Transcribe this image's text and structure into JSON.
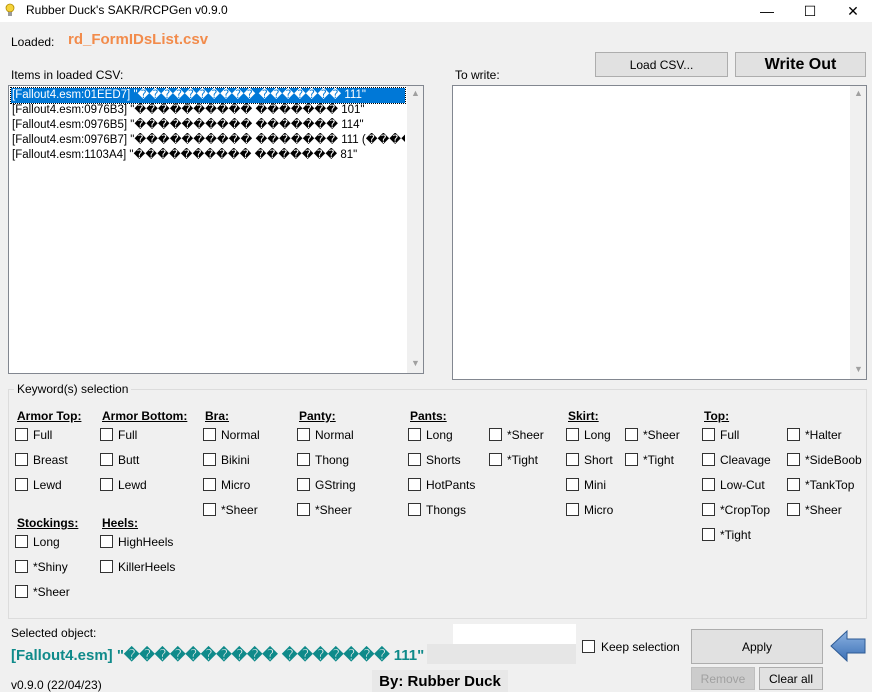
{
  "window": {
    "title": "Rubber Duck's SAKR/RCPGen v0.9.0",
    "minimize": "—",
    "maximize": "☐",
    "close": "✕"
  },
  "loaded": {
    "label": "Loaded:",
    "filename": "rd_FormIDsList.csv"
  },
  "csv_list": {
    "label": "Items in loaded CSV:",
    "items": [
      "[Fallout4.esm:01EED7] \"���������� ������� 111\"",
      "[Fallout4.esm:0976B3] \"���������� ������� 101\"",
      "[Fallout4.esm:0976B5] \"���������� ������� 114\"",
      "[Fallout4.esm:0976B7] \"���������� ������� 111 (�����",
      "[Fallout4.esm:1103A4] \"���������� ������� 81\""
    ]
  },
  "write_panel": {
    "label": "To write:",
    "load_csv": "Load CSV...",
    "write_out": "Write Out"
  },
  "keywords": {
    "group_title": "Keyword(s) selection",
    "armor_top": {
      "title": "Armor Top:",
      "options": [
        "Full",
        "Breast",
        "Lewd"
      ]
    },
    "armor_bottom": {
      "title": "Armor Bottom:",
      "options": [
        "Full",
        "Butt",
        "Lewd"
      ]
    },
    "bra": {
      "title": "Bra:",
      "options": [
        "Normal",
        "Bikini",
        "Micro",
        "*Sheer"
      ]
    },
    "panty": {
      "title": "Panty:",
      "options": [
        "Normal",
        "Thong",
        "GString",
        "*Sheer"
      ]
    },
    "pants": {
      "title": "Pants:",
      "options": [
        "Long",
        "Shorts",
        "HotPants",
        "Thongs",
        "*Sheer",
        "*Tight"
      ]
    },
    "skirt": {
      "title": "Skirt:",
      "options": [
        "Long",
        "Short",
        "Mini",
        "Micro",
        "*Sheer",
        "*Tight"
      ]
    },
    "top": {
      "title": "Top:",
      "options": [
        "Full",
        "Cleavage",
        "Low-Cut",
        "*CropTop",
        "*Tight",
        "*Halter",
        "*SideBoob",
        "*TankTop",
        "*Sheer"
      ]
    },
    "stockings": {
      "title": "Stockings:",
      "options": [
        "Long",
        "*Shiny",
        "*Sheer"
      ]
    },
    "heels": {
      "title": "Heels:",
      "options": [
        "HighHeels",
        "KillerHeels"
      ]
    }
  },
  "footer": {
    "selected_label": "Selected object:",
    "selected_value": "[Fallout4.esm] \"���������� ������� 111\"",
    "keep_selection": "Keep selection",
    "apply": "Apply",
    "remove": "Remove",
    "clear_all": "Clear all",
    "version": "v0.9.0 (22/04/23)",
    "author": "By: Rubber Duck"
  },
  "colors": {
    "loaded_filename": "#f28b4b",
    "selected_object": "#0f8a8a",
    "selection_highlight": "#0078d7",
    "arrow": "#4a7fc1"
  }
}
